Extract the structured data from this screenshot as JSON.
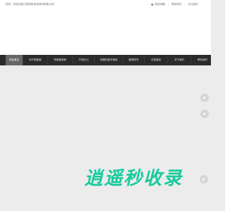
{
  "topbar": {
    "welcome": "您好，欢迎光临江西研发电池材料有限公司！",
    "links": [
      "网站地图",
      "联系我们",
      "关注我们"
    ]
  },
  "nav": {
    "items": [
      "网站首页",
      "电子智能锁",
      "机械锁铁阀",
      "产品中心",
      "电梯防盗专用锁",
      "新闻资讯",
      "在线留言",
      "关于我们",
      "联系我们"
    ],
    "active_index": 0
  },
  "watermark": {
    "text": "逍遥秒收录"
  },
  "colors": {
    "nav_bg": "#2b2b2b",
    "nav_active": "#666666",
    "watermark": "#00c896"
  }
}
